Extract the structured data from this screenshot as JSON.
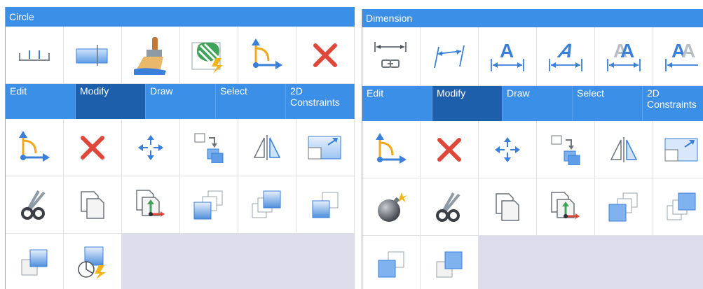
{
  "colors": {
    "title_bar": "#3c8fe6",
    "tab_active": "#1d5faa",
    "panel_bg": "#dcdcea",
    "icon_blue": "#3a7fd8",
    "icon_red": "#e0473b"
  },
  "left_panel": {
    "title": "Circle",
    "top_icons": [
      "ortho-dimension-icon",
      "boundary-box-icon",
      "paintbrush-icon",
      "hatch-edit-icon",
      "move-gizmo-icon",
      "delete-icon"
    ],
    "tabs": [
      "Edit",
      "Modify",
      "Draw",
      "Select",
      "2D Constraints"
    ],
    "active_tab": "Modify",
    "row1": [
      "move-gizmo-icon",
      "delete-icon",
      "move-icon",
      "copy-to-icon",
      "mirror-icon",
      "scale-icon"
    ],
    "row2": [
      "scissors-icon",
      "copy-icon",
      "paste-icon",
      "send-to-back-icon",
      "bring-to-front-icon",
      "send-backward-icon"
    ],
    "row3": [
      "bring-forward-icon",
      "circle-quick-edit-icon"
    ]
  },
  "right_panel": {
    "title": "Dimension",
    "top_icons": [
      "linked-dimension-icon",
      "aligned-dimension-icon",
      "dimension-text-icon",
      "dimension-text-oblique-icon",
      "dimension-text-gray-icon",
      "dimension-text-caps-icon"
    ],
    "tabs": [
      "Edit",
      "Modify",
      "Draw",
      "Select",
      "2D Constraints"
    ],
    "active_tab": "Modify",
    "row1": [
      "move-gizmo-icon",
      "delete-icon",
      "move-icon",
      "copy-to-icon",
      "mirror-icon",
      "scale-icon"
    ],
    "row2": [
      "explode-icon",
      "scissors-icon",
      "copy-icon",
      "paste-icon",
      "send-to-back-icon",
      "bring-to-front-icon"
    ],
    "row3": [
      "send-backward-icon",
      "bring-forward-icon"
    ]
  }
}
